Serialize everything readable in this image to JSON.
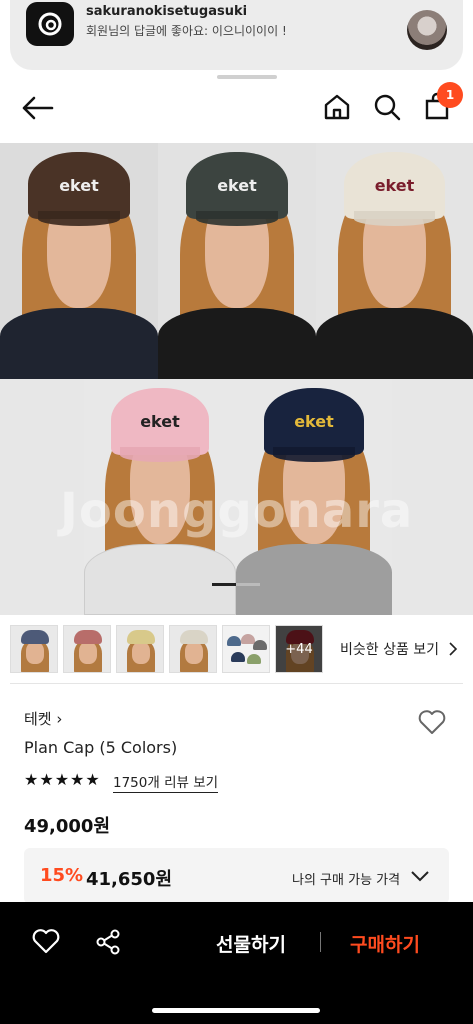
{
  "notification": {
    "sender": "sakuranokisetugasuki",
    "message": "회원님의 답글에 좋아요: 이으니이이이 !",
    "app_icon": "threads-icon"
  },
  "nav": {
    "icons": [
      "back-arrow-icon",
      "home-icon",
      "search-icon",
      "shopping-bag-icon"
    ],
    "cart_count": "1"
  },
  "hero": {
    "watermark": "Joonggonara",
    "cap_text": "eket",
    "slide_index": 1,
    "slide_total": 2
  },
  "thumbnails": {
    "more_label": "+44",
    "similar_label": "비슷한 상품 보기"
  },
  "product": {
    "brand": "테켓",
    "name": "Plan Cap (5 Colors)",
    "rating": 5,
    "reviews_label": "1750개 리뷰 보기",
    "price": "49,000원",
    "discount_pct": "15%",
    "sale_price": "41,650원",
    "my_price_label": "나의 구매 가능 가격"
  },
  "bottom_bar": {
    "gift_label": "선물하기",
    "buy_label": "구매하기"
  },
  "colors": {
    "accent": "#ff4b1f",
    "bottom_bar_bg": "#000000"
  }
}
